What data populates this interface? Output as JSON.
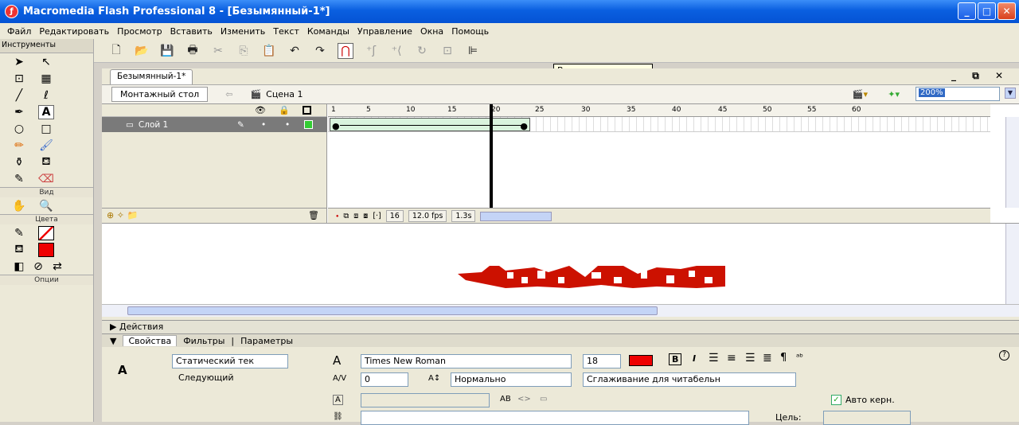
{
  "window": {
    "title": "Macromedia Flash Professional 8 - [Безымянный-1*]",
    "app_icon": "flash-logo-icon"
  },
  "menu": [
    "Файл",
    "Редактировать",
    "Просмотр",
    "Вставить",
    "Изменить",
    "Текст",
    "Команды",
    "Управление",
    "Окна",
    "Помощь"
  ],
  "tools": {
    "header": "Инструменты",
    "view_label": "Вид",
    "colors_label": "Цвета",
    "options_label": "Опции"
  },
  "tooltip": "Вращение и наклон",
  "document": {
    "tab": "Безымянный-1*",
    "stage_button": "Монтажный стол",
    "scene": "Сцена 1",
    "zoom": "200%"
  },
  "timeline": {
    "layer_name": "Слой 1",
    "ruler": [
      "1",
      "5",
      "10",
      "15",
      "20",
      "25",
      "30",
      "35",
      "40",
      "45",
      "50",
      "55",
      "60"
    ],
    "current_frame": "16",
    "fps": "12.0 fps",
    "time": "1.3s"
  },
  "actions_label": "Действия",
  "properties": {
    "tabs": [
      "Свойства",
      "Фильтры",
      "Параметры"
    ],
    "text_type": "Статический тек",
    "next_label": "Следующий",
    "font": "Times New Roman",
    "size": "18",
    "tracking": "0",
    "baseline": "Нормально",
    "antialias": "Сглаживание для читабельн",
    "autokern": "Авто керн.",
    "target_label": "Цель:"
  },
  "colors": {
    "accent": "#cc1100",
    "titlebar": "#0a5fe0"
  }
}
